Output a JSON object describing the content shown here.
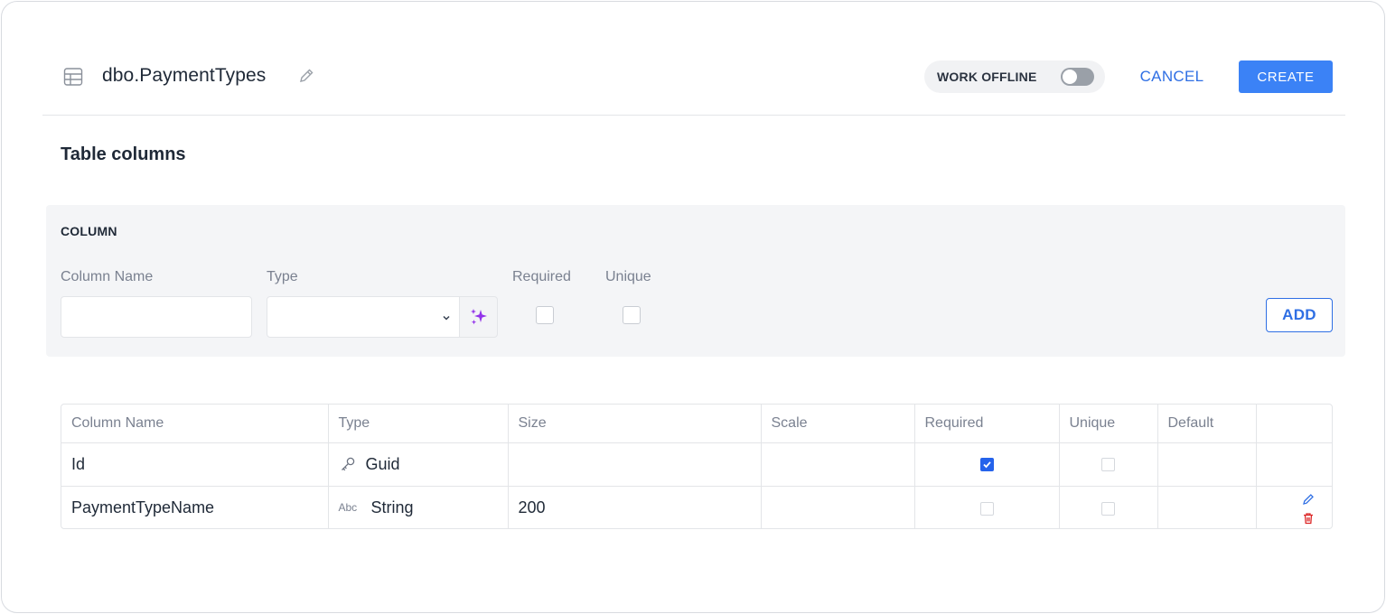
{
  "header": {
    "title": "dbo.PaymentTypes",
    "work_offline_label": "WORK OFFLINE",
    "work_offline_enabled": false,
    "cancel_label": "CANCEL",
    "create_label": "CREATE"
  },
  "section_title": "Table columns",
  "column_form": {
    "heading": "COLUMN",
    "name_label": "Column Name",
    "name_value": "",
    "type_label": "Type",
    "type_value": "",
    "required_label": "Required",
    "required_checked": false,
    "unique_label": "Unique",
    "unique_checked": false,
    "add_label": "ADD"
  },
  "table": {
    "headers": [
      "Column Name",
      "Type",
      "Size",
      "Scale",
      "Required",
      "Unique",
      "Default",
      ""
    ],
    "rows": [
      {
        "name": "Id",
        "type_icon": "key-icon",
        "type": "Guid",
        "size": "",
        "scale": "",
        "required": true,
        "unique": false,
        "default": "",
        "editable": false
      },
      {
        "name": "PaymentTypeName",
        "type_icon": "abc-icon",
        "type_icon_text": "Abc",
        "type": "String",
        "size": "200",
        "scale": "",
        "required": false,
        "unique": false,
        "default": "",
        "editable": true
      }
    ]
  },
  "colors": {
    "accent": "#3b82f6",
    "link": "#2f6fe4",
    "danger": "#dc2626",
    "sparkle": "#9333ea"
  }
}
